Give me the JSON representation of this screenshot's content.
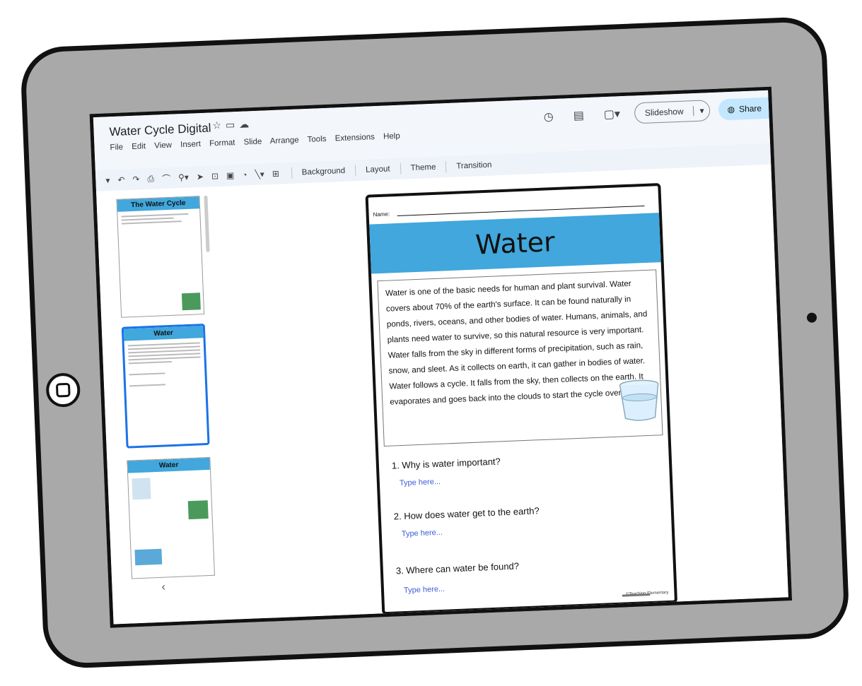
{
  "app": {
    "doc_title": "Water Cycle Digital",
    "title_icons": [
      "star-icon",
      "folder-icon",
      "cloud-icon"
    ],
    "menu": [
      "File",
      "Edit",
      "View",
      "Insert",
      "Format",
      "Slide",
      "Arrange",
      "Tools",
      "Extensions",
      "Help"
    ]
  },
  "header": {
    "slideshow_label": "Slideshow",
    "share_label": "Share"
  },
  "toolbar": {
    "background_label": "Background",
    "layout_label": "Layout",
    "theme_label": "Theme",
    "transition_label": "Transition"
  },
  "filmstrip": {
    "thumb1_title": "The Water Cycle",
    "thumb2_title": "Water",
    "thumb3_title": "Water"
  },
  "slide": {
    "name_label": "Name:",
    "title": "Water",
    "passage": "Water is one of the basic needs for human and plant survival. Water covers about 70% of the earth's surface. It can be found naturally in ponds, rivers, oceans, and other bodies of water. Humans, animals, and plants need water to survive, so this natural resource is very important. Water falls from the sky in different forms of precipitation, such as rain, snow, and sleet. As it collects on earth, it can gather in bodies of water. Water follows a cycle. It falls from the sky, then collects on the earth. It evaporates and goes back into the clouds to start the cycle over again.",
    "questions": [
      {
        "q": "1. Why is water important?",
        "a": "Type here..."
      },
      {
        "q": "2. How does water get to the earth?",
        "a": "Type here..."
      },
      {
        "q": "3. Where can water be found?",
        "a": "Type here..."
      }
    ],
    "copyright": "©Teaching Elementary"
  },
  "colors": {
    "banner": "#41a7dc",
    "answer_text": "#3b5bd9",
    "share_bg": "#c2e7ff",
    "tablet_body": "#a9a9a9"
  }
}
